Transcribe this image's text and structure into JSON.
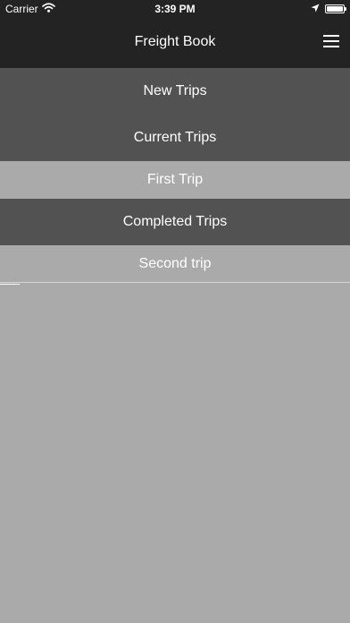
{
  "status_bar": {
    "carrier": "Carrier",
    "time": "3:39 PM",
    "wifi_icon": "wifi-icon",
    "location_icon": "location-arrow-icon",
    "battery_icon": "battery-icon"
  },
  "header": {
    "title": "Freight Book",
    "menu_icon": "hamburger-menu-icon"
  },
  "menu": {
    "new_trips": "New Trips",
    "current_trips": "Current Trips",
    "first_trip": "First Trip",
    "completed_trips": "Completed Trips",
    "second_trip": "Second trip"
  },
  "colors": {
    "header_bg": "#232323",
    "section_bg": "#525252",
    "trip_bg": "#aaaaaa",
    "text": "#ffffff"
  }
}
